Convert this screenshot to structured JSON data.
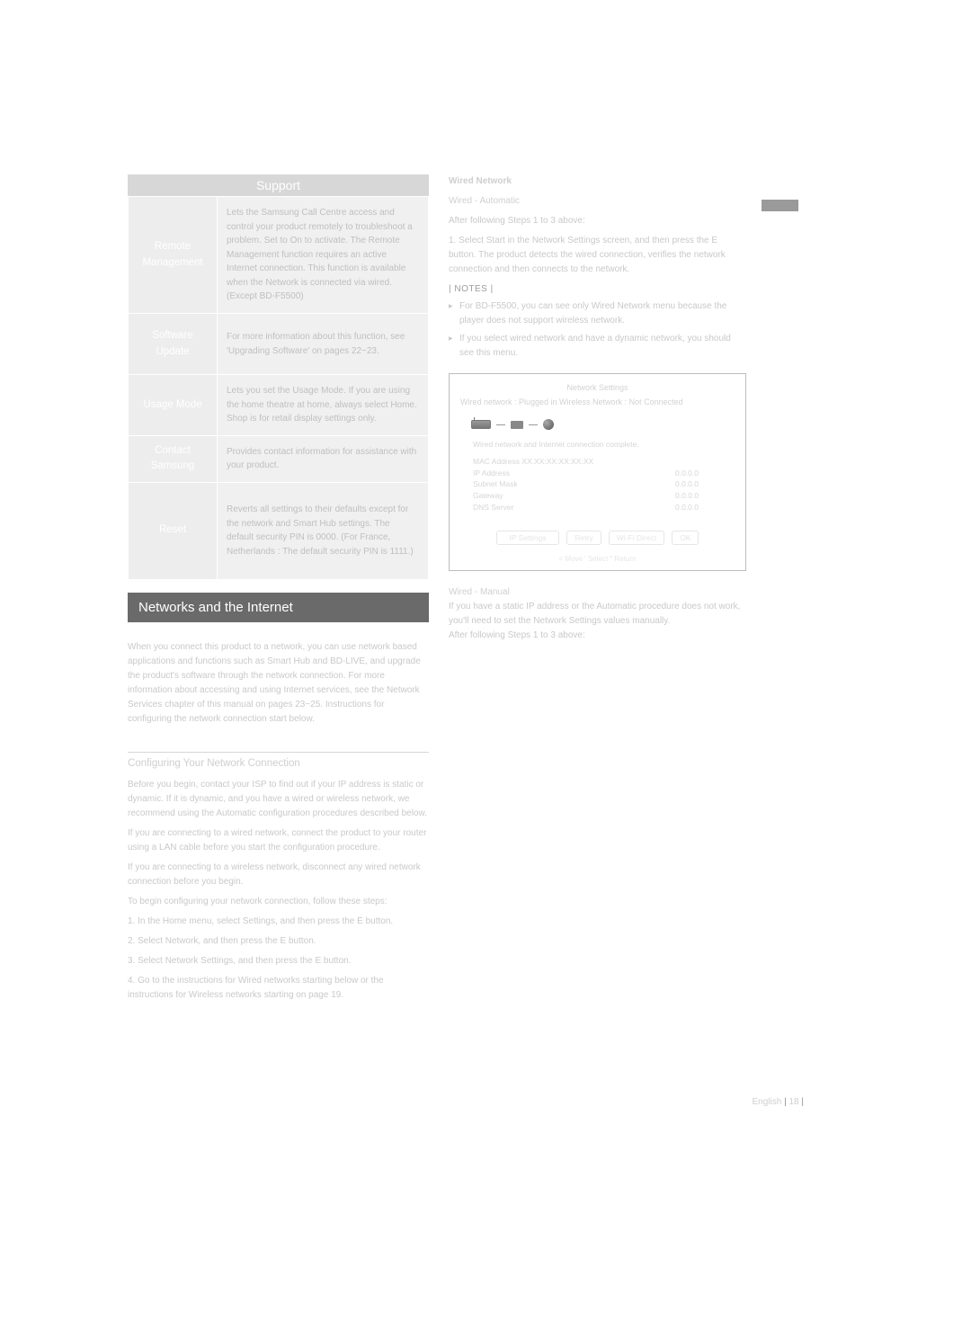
{
  "support": {
    "header": "Support",
    "rows": [
      {
        "label": "Remote Management",
        "desc": "Lets the Samsung Call Centre access and control your product remotely to troubleshoot a problem. Set to On to activate. The Remote Management function requires an active Internet connection. This function is available when the Network is connected via wired. (Except BD-F5500)"
      },
      {
        "label": "Software Update",
        "desc": "For more information about this function, see 'Upgrading Software' on pages 22~23."
      },
      {
        "label": "Usage Mode",
        "desc": "Lets you set the Usage Mode. If you are using the home theatre at home, always select Home. Shop is for retail display settings only."
      },
      {
        "label": "Contact Samsung",
        "desc": "Provides contact information for assistance with your product."
      },
      {
        "label": "Reset",
        "desc": "Reverts all settings to their defaults except for the network and Smart Hub settings. The default security PIN is 0000. (For France, Netherlands : The default security PIN is 1111.)"
      }
    ]
  },
  "sectionBanner": "Networks and the Internet",
  "intro": "When you connect this product to a network, you can use network based applications and functions such as Smart Hub and BD-LIVE, and upgrade the product's software through the network connection. For more information about accessing and using Internet services, see the Network Services chapter of this manual on pages 23~25. Instructions for configuring the network connection start below.",
  "subhead": "Configuring Your Network Connection",
  "leftBody": [
    "Before you begin, contact your ISP to find out if your IP address is static or dynamic. If it is dynamic, and you have a wired or wireless network, we recommend using the Automatic configuration procedures described below.",
    "If you are connecting to a wired network, connect the product to your router using a LAN cable before you start the configuration procedure.",
    "If you are connecting to a wireless network, disconnect any wired network connection before you begin.",
    "To begin configuring your network connection, follow these steps:",
    "1. In the Home menu, select Settings, and then press the E button.",
    "2. Select Network, and then press the E button.",
    "3. Select Network Settings, and then press the E button.",
    "4. Go to the instructions for Wired networks starting below or the instructions for Wireless networks starting on page 19."
  ],
  "rightTop": {
    "wiredHeader": "Wired Network",
    "wiredSub": "Wired - Automatic",
    "preNotes": "After following Steps 1 to 3 above:",
    "step1": "1. Select Start in the Network Settings screen, and then press the E button. The product detects the wired connection, verifies the network connection and then connects to the network."
  },
  "notesLabel": "| NOTES |",
  "notes": [
    "For BD-F5500, you can see only Wired Network menu because the player does not support wireless network.",
    "If you select wired network and have a dynamic network, you should see this menu."
  ],
  "networkBox": {
    "title": "Network Settings",
    "wiredType": "Wired network : Plugged in Wireless Network : Not Connected",
    "statusLine": "Wired network and Internet connection complete.",
    "mac": "MAC Address  XX:XX:XX:XX:XX:XX",
    "ipLabel": "IP Address",
    "ipVal": "0.0.0.0",
    "subnetLabel": "Subnet Mask",
    "subnetVal": "0.0.0.0",
    "gatewayLabel": "Gateway",
    "gatewayVal": "0.0.0.0",
    "dnsLabel": "DNS Server",
    "dnsVal": "0.0.0.0",
    "btnIP": "IP Settings",
    "btnRetry": "Retry",
    "btnWps": "Wi-Fi Direct",
    "btnOK": "OK",
    "move": "< Move    ' Select    \" Return"
  },
  "belowBox": {
    "manualHeader": "Wired - Manual",
    "manualBody": "If you have a static IP address or the Automatic procedure does not work, you'll need to set the Network Settings values manually.",
    "manualAfter": "After following Steps 1 to 3 above:"
  },
  "footer": {
    "english": "English",
    "page": "18"
  }
}
